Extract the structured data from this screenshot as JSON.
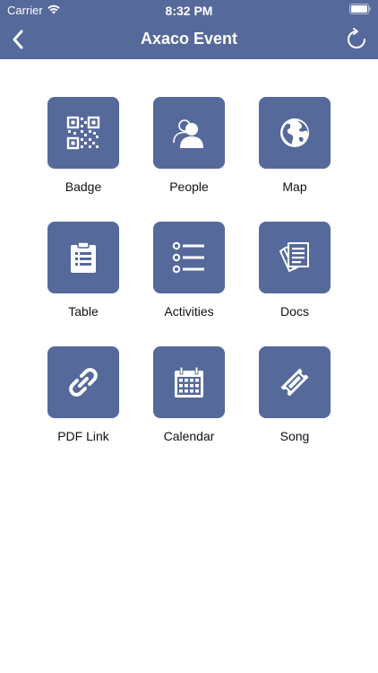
{
  "status": {
    "carrier": "Carrier",
    "time": "8:32 PM"
  },
  "nav": {
    "title": "Axaco Event"
  },
  "tiles": [
    {
      "label": "Badge",
      "icon": "qr-code-icon"
    },
    {
      "label": "People",
      "icon": "people-icon"
    },
    {
      "label": "Map",
      "icon": "globe-icon"
    },
    {
      "label": "Table",
      "icon": "clipboard-icon"
    },
    {
      "label": "Activities",
      "icon": "list-icon"
    },
    {
      "label": "Docs",
      "icon": "documents-icon"
    },
    {
      "label": "PDF Link",
      "icon": "link-icon"
    },
    {
      "label": "Calendar",
      "icon": "calendar-icon"
    },
    {
      "label": "Song",
      "icon": "ticket-icon"
    }
  ],
  "colors": {
    "accent": "#56699b",
    "text": "#111111",
    "background": "#ffffff"
  }
}
